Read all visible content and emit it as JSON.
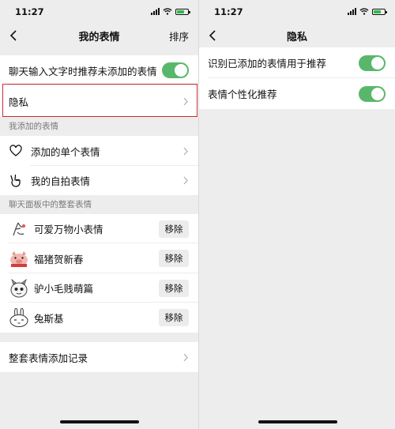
{
  "status_bar": {
    "time": "11:27"
  },
  "left_screen": {
    "nav": {
      "title": "我的表情",
      "action": "排序"
    },
    "settings": {
      "recommend_label": "聊天输入文字时推荐未添加的表情",
      "recommend_on": true,
      "privacy_label": "隐私"
    },
    "my_added": {
      "header": "我添加的表情",
      "items": [
        {
          "label": "添加的单个表情",
          "icon": "heart-icon"
        },
        {
          "label": "我的自拍表情",
          "icon": "peace-hand-icon"
        }
      ]
    },
    "sets": {
      "header": "聊天面板中的整套表情",
      "remove_label": "移除",
      "items": [
        {
          "name": "可爱万物小表情",
          "thumb": "cute-doodle-thumb"
        },
        {
          "name": "福猪贺新春",
          "thumb": "lucky-pig-thumb"
        },
        {
          "name": "驴小毛贱萌篇",
          "thumb": "donkey-thumb"
        },
        {
          "name": "兔斯基",
          "thumb": "tuzki-thumb"
        }
      ]
    },
    "history_label": "整套表情添加记录"
  },
  "right_screen": {
    "nav": {
      "title": "隐私"
    },
    "settings": [
      {
        "label": "识别已添加的表情用于推荐",
        "on": true
      },
      {
        "label": "表情个性化推荐",
        "on": true
      }
    ]
  }
}
